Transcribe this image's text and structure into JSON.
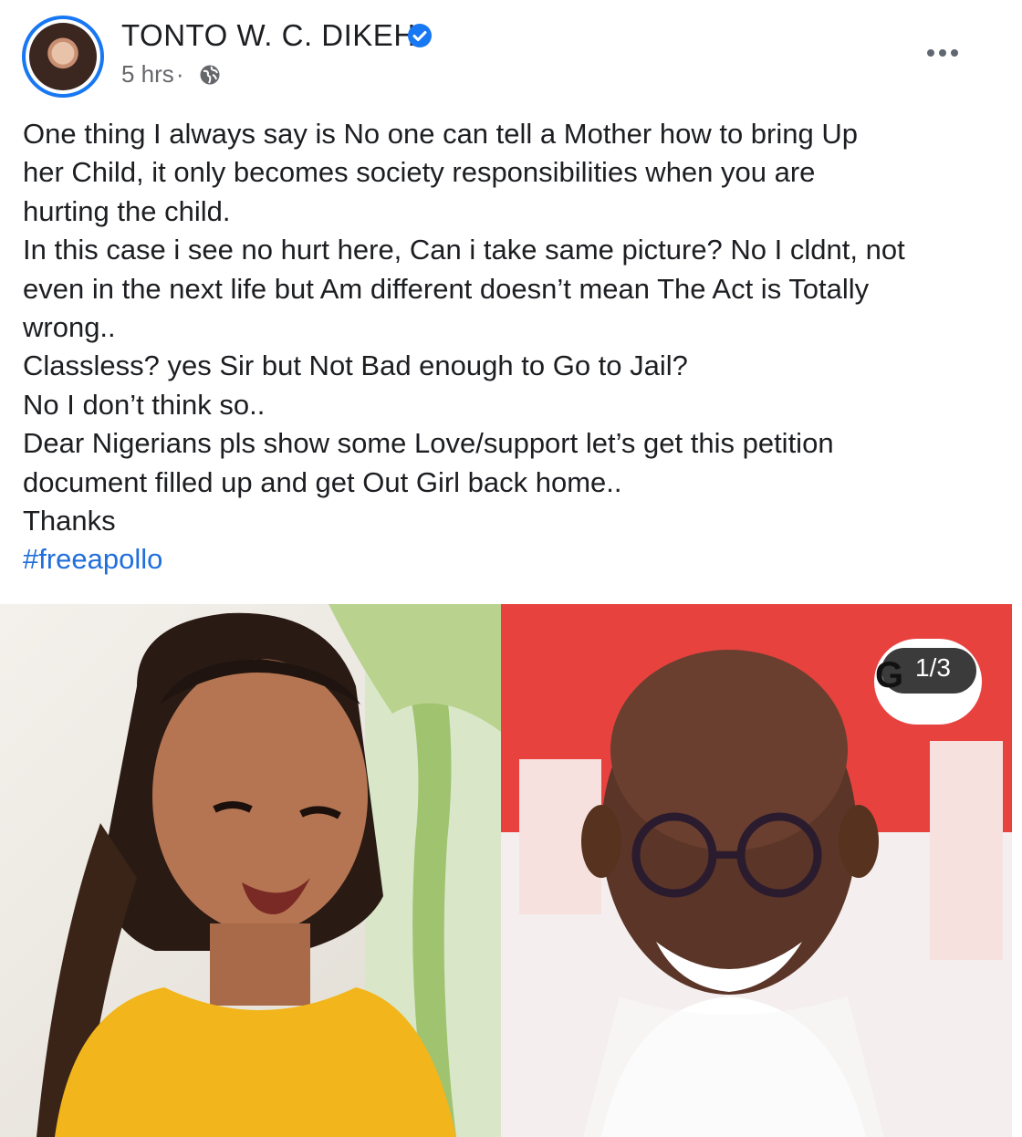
{
  "post": {
    "author": "TONTO W. C. DIKEH",
    "verified_icon": "verified-badge-icon",
    "time": "5 hrs",
    "separator": "·",
    "audience_icon": "globe-icon",
    "more_icon": "more-options-icon",
    "text_lines": [
      "One thing I always say is No one can tell a Mother how to bring Up",
      "her Child, it only becomes society responsibilities when you are",
      "hurting the child.",
      "In this case i see no hurt here, Can i take same picture? No I cldnt, not",
      "even in the next life but Am different doesn’t mean The Act is Totally",
      "wrong..",
      "Classless? yes Sir but Not Bad enough to Go to Jail?",
      "No I don’t think so..",
      "Dear Nigerians pls show some Love/support let’s get this petition",
      "document filled up and get Out Girl back home..",
      "Thanks"
    ],
    "hashtag": "#freeapollo"
  },
  "gallery": {
    "counter": "1/3",
    "counter_logo": "G",
    "colors": {
      "accent": "#1877f2",
      "hashtag": "#216fdb",
      "meta": "#65676b"
    }
  }
}
